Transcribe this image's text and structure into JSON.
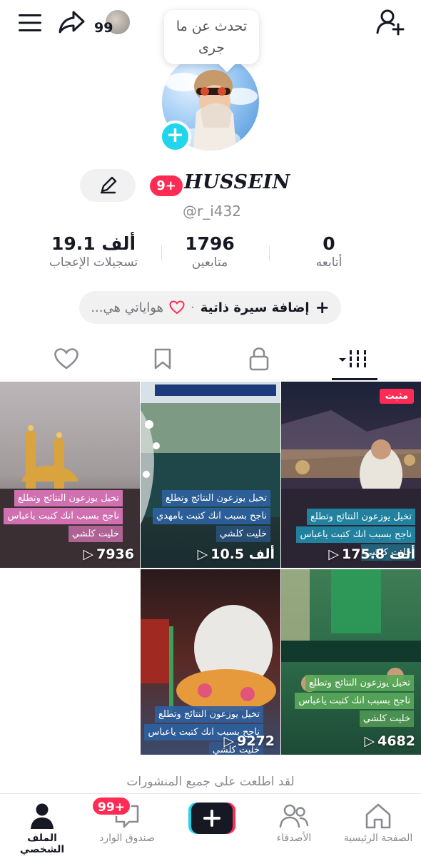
{
  "topbar": {
    "story_count": "99",
    "bubble_text_line1": "تحدث عن ما",
    "bubble_text_line2": "جرى"
  },
  "profile": {
    "name": "HUSSEIN",
    "notification_badge": "9+",
    "username": "@r_i432"
  },
  "stats": [
    {
      "value": "0",
      "label": "أتابعه"
    },
    {
      "value": "1796",
      "label": "متابعين"
    },
    {
      "value": "19.1 ألف",
      "label": "تسجيلات الإعجاب"
    }
  ],
  "bio": {
    "add_label": "إضافة سيرة ذاتية",
    "separator": "·",
    "hobbies_placeholder": "هواياتي هي..."
  },
  "tabs": [
    {
      "icon": "grid-icon",
      "active": true
    },
    {
      "icon": "lock-icon",
      "active": false
    },
    {
      "icon": "bookmark-icon",
      "active": false
    },
    {
      "icon": "heart-icon",
      "active": false
    }
  ],
  "videos": [
    {
      "caption_line1": "تخيل يوزعون النتائج وتطلع",
      "caption_line2": "ناجح بسبب انك كتبت ياعباس",
      "caption_line3": "خليت كلشي",
      "views": "175.8 ألف",
      "pinned_label": "مثبت"
    },
    {
      "caption_line1": "تخيل يوزعون النتائج وتطلع",
      "caption_line2": "ناجح بسبب انك كتبت يامهدي",
      "caption_line3": "خليت كلشي",
      "views": "10.5 ألف"
    },
    {
      "caption_line1": "تخيل يوزعون النتائج وتطلع",
      "caption_line2": "ناجح بسبب انك كتبت ياعباس",
      "caption_line3": "خليت كلشي",
      "views": "7936"
    },
    {
      "caption_line1": "تخيل يوزعون النتائج وتطلع",
      "caption_line2": "ناجح بسبب انك كتبت ياعباس",
      "caption_line3": "خليت كلشي",
      "views": "4682"
    },
    {
      "caption_line1": "تخيل يوزعون النتائج وتطلع",
      "caption_line2": "ناجح بسبب انك كتبت ياعباس",
      "caption_line3": "خليت كلشي",
      "views": "9272"
    }
  ],
  "footer_text": "لقد اطلعت على جميع المنشورات",
  "bottom_nav": {
    "home": "الصفحة الرئيسية",
    "friends": "الأصدقاء",
    "inbox": "صندوق الوارد",
    "inbox_badge": "99+",
    "profile": "الملف الشخصي"
  },
  "colors": {
    "accent": "#fe2c55",
    "cyan": "#20d5ec"
  }
}
